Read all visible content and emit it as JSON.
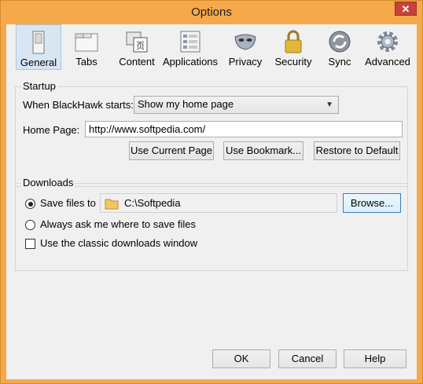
{
  "window": {
    "title": "Options",
    "close_label": "✕"
  },
  "toolbar": {
    "items": [
      {
        "label": "General",
        "icon": "general-switch-icon",
        "selected": true
      },
      {
        "label": "Tabs",
        "icon": "tabs-window-icon"
      },
      {
        "label": "Content",
        "icon": "content-page-icon"
      },
      {
        "label": "Applications",
        "icon": "applications-list-icon"
      },
      {
        "label": "Privacy",
        "icon": "privacy-mask-icon"
      },
      {
        "label": "Security",
        "icon": "security-lock-icon"
      },
      {
        "label": "Sync",
        "icon": "sync-arrows-icon"
      },
      {
        "label": "Advanced",
        "icon": "advanced-gear-icon"
      }
    ]
  },
  "startup": {
    "legend": "Startup",
    "when_starts_label": "When BlackHawk starts:",
    "when_starts_value": "Show my home page",
    "homepage_label": "Home Page:",
    "homepage_value": "http://www.softpedia.com/",
    "use_current_page": "Use Current Page",
    "use_bookmark": "Use Bookmark...",
    "restore_default": "Restore to Default"
  },
  "downloads": {
    "legend": "Downloads",
    "save_files_label": "Save files to",
    "save_path": "C:\\Softpedia",
    "browse": "Browse...",
    "always_ask_label": "Always ask me where to save files",
    "classic_window_label": "Use the classic downloads window"
  },
  "footer": {
    "ok": "OK",
    "cancel": "Cancel",
    "help": "Help"
  },
  "colors": {
    "titlebar": "#f5a94a",
    "selected_tab": "#d8e6f4",
    "close": "#c7423c"
  }
}
